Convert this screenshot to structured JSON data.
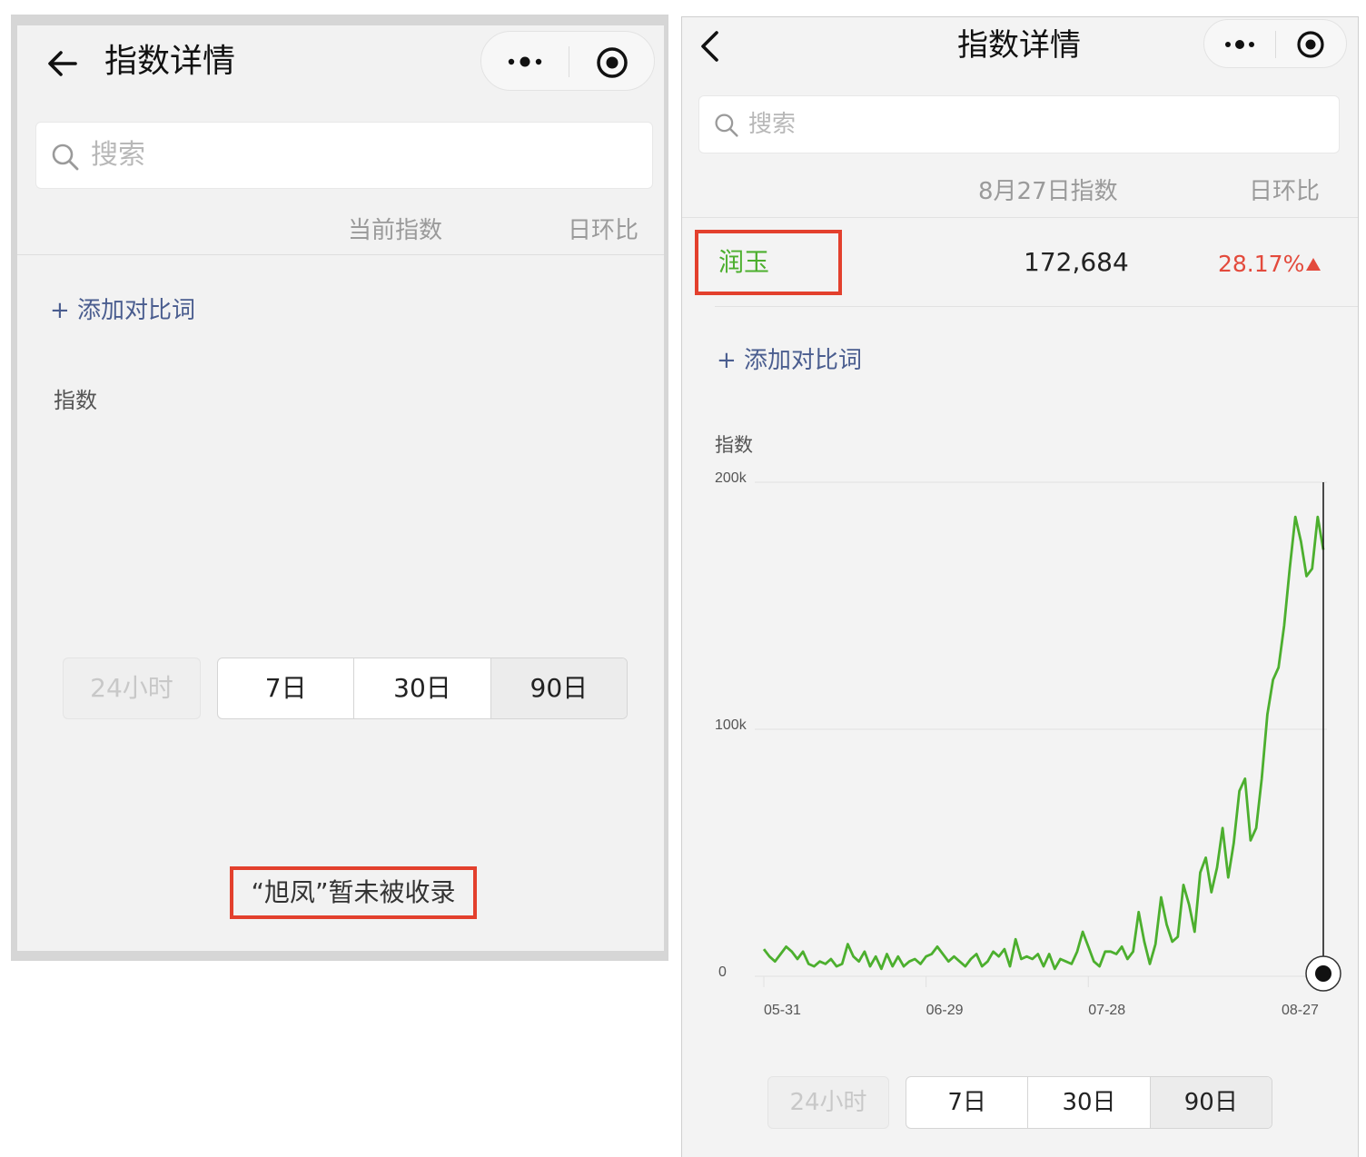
{
  "left": {
    "header": {
      "title": "指数详情"
    },
    "search": {
      "placeholder": "搜索"
    },
    "table_header": {
      "col1": "当前指数",
      "col2": "日环比"
    },
    "add_compare": "+ 添加对比词",
    "chart_label": "指数",
    "range": {
      "disabled": "24小时",
      "options": [
        "7日",
        "30日",
        "90日"
      ],
      "selected": "90日"
    },
    "message": "“旭凤”暂未被收录"
  },
  "right": {
    "header": {
      "title": "指数详情"
    },
    "search": {
      "placeholder": "搜索"
    },
    "table_header": {
      "col1": "8月27日指数",
      "col2": "日环比"
    },
    "row": {
      "term": "润玉",
      "value": "172,684",
      "change": "28.17%",
      "trend": "up"
    },
    "add_compare": "+ 添加对比词",
    "chart_label": "指数",
    "range": {
      "disabled": "24小时",
      "options": [
        "7日",
        "30日",
        "90日"
      ],
      "selected": "90日"
    }
  },
  "colors": {
    "accent_green": "#4caf2e",
    "up_red": "#e34a3c",
    "highlight_box": "#e3402d",
    "link_blue": "#4a5d8f"
  },
  "chart_data": {
    "type": "line",
    "ylim": [
      0,
      200000
    ],
    "y_ticks": [
      "0",
      "100k",
      "200k"
    ],
    "x_ticks": [
      "05-31",
      "06-29",
      "07-28",
      "08-27"
    ],
    "grid": true,
    "series": [
      {
        "name": "润玉",
        "color": "#4caf2e",
        "values": [
          11000,
          8000,
          6000,
          9000,
          12000,
          10000,
          7000,
          10000,
          5000,
          4000,
          6000,
          5000,
          7000,
          4000,
          5000,
          13000,
          8000,
          6000,
          10000,
          4000,
          8000,
          3000,
          9000,
          4000,
          8000,
          4000,
          6000,
          7000,
          5000,
          8000,
          9000,
          12000,
          9000,
          6000,
          8000,
          6000,
          4000,
          7000,
          9000,
          4000,
          6000,
          10000,
          8000,
          11000,
          4000,
          15000,
          7000,
          8000,
          7000,
          9000,
          4000,
          9000,
          3000,
          7000,
          6000,
          5000,
          10000,
          18000,
          12000,
          6000,
          4000,
          10000,
          10000,
          9000,
          12000,
          7000,
          10000,
          26000,
          14000,
          5000,
          13000,
          32000,
          21000,
          14000,
          16000,
          37000,
          29000,
          18000,
          42000,
          48000,
          34000,
          44000,
          60000,
          40000,
          54000,
          75000,
          80000,
          55000,
          60000,
          80000,
          106000,
          120000,
          125000,
          142000,
          165000,
          186000,
          176000,
          162000,
          165000,
          186000,
          172684
        ]
      }
    ]
  }
}
